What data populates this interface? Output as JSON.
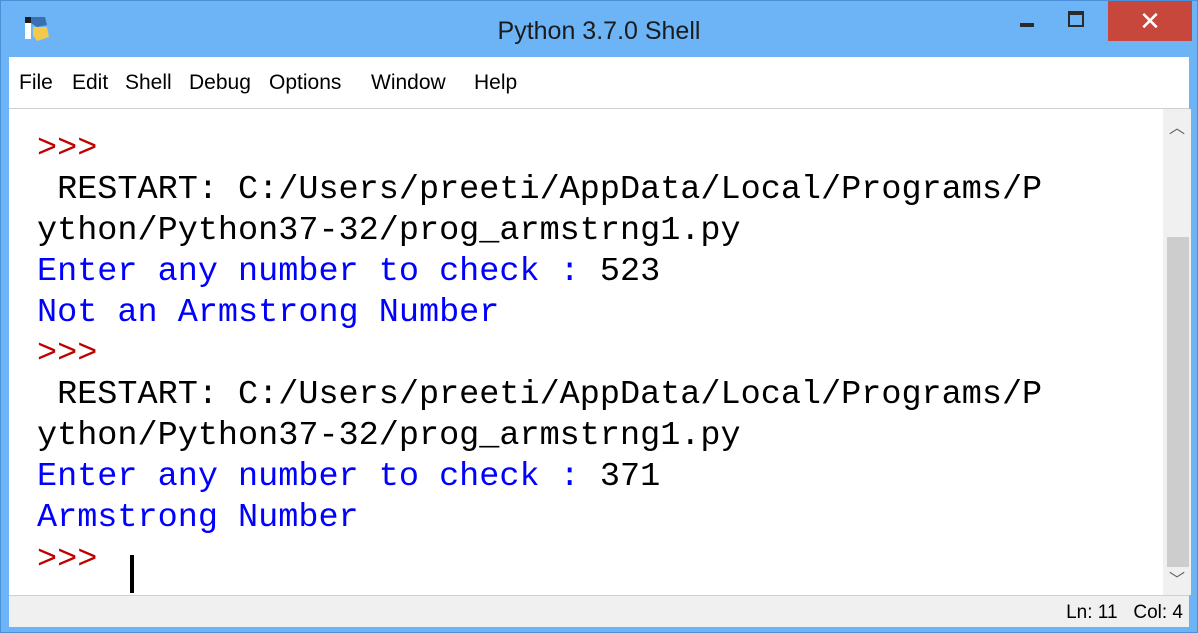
{
  "window": {
    "title": "Python 3.7.0 Shell",
    "close_glyph": "✕"
  },
  "menu": [
    "File",
    "Edit",
    "Shell",
    "Debug",
    "Options",
    "Window",
    "Help"
  ],
  "shell": {
    "lines": [
      {
        "type": "prompt",
        "text": ">>>"
      },
      {
        "type": "restart",
        "text": " RESTART: C:/Users/preeti/AppData/Local/Programs/P"
      },
      {
        "type": "restart",
        "text": "ython/Python37-32/prog_armstrng1.py"
      },
      {
        "type": "input",
        "text": "Enter any number to check : ",
        "value": "523"
      },
      {
        "type": "output",
        "text": "Not an Armstrong Number"
      },
      {
        "type": "prompt",
        "text": ">>>"
      },
      {
        "type": "restart",
        "text": " RESTART: C:/Users/preeti/AppData/Local/Programs/P"
      },
      {
        "type": "restart",
        "text": "ython/Python37-32/prog_armstrng1.py"
      },
      {
        "type": "input",
        "text": "Enter any number to check : ",
        "value": "371"
      },
      {
        "type": "output",
        "text": "Armstrong Number"
      },
      {
        "type": "prompt",
        "text": ">>> "
      }
    ]
  },
  "status": {
    "ln": "Ln: 11",
    "col": "Col: 4"
  },
  "colors": {
    "titlebar": "#6cb4f6",
    "close_button": "#c7473c",
    "prompt": "#c00000",
    "output": "#0000ff"
  }
}
